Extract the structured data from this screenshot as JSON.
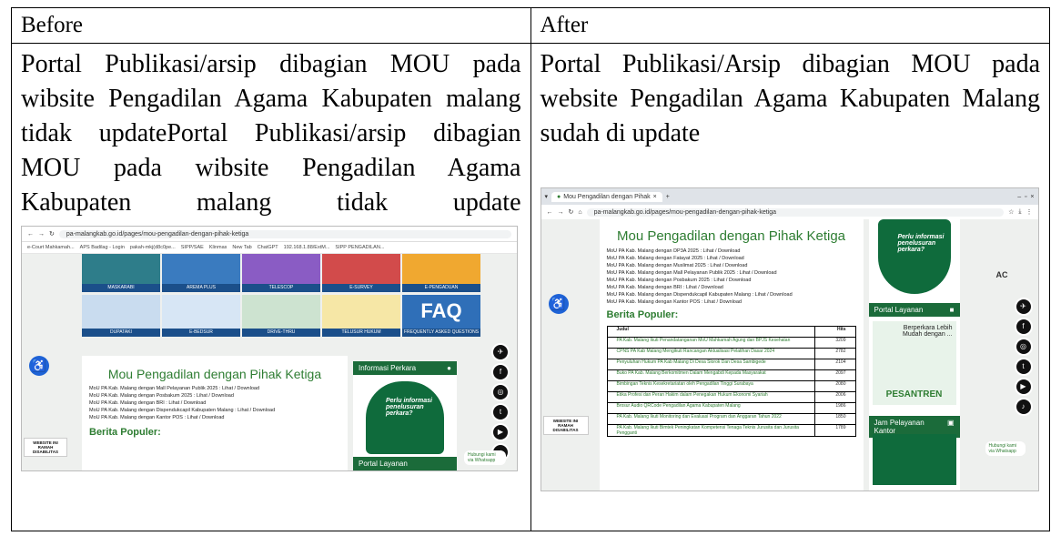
{
  "table": {
    "before_header": "Before",
    "after_header": "After",
    "before_text": "Portal Publikasi/arsip dibagian MOU pada wibsite Pengadilan Agama Kabupaten malang tidak updatePortal Publikasi/arsip dibagian MOU pada wibsite Pengadilan Agama Kabupaten malang tidak update",
    "after_text": "Portal Publikasi/Arsip dibagian MOU pada website Pengadilan Agama Kabupaten Malang sudah di update"
  },
  "before_shot": {
    "url": "pa-malangkab.go.id/pages/mou-pengadilan-dengan-pihak-ketiga",
    "bookmarks": [
      "e-Court Mahkamah...",
      "APS Badilag - Login",
      "pakah-mkj(d8c0pe...",
      "SIPP/SAE",
      "Klinmas",
      "New Tab",
      "ChatGPT",
      "192.168.1.88/ExtM...",
      "SIPP PENGADILAN..."
    ],
    "tiles_top": [
      "MASKARABI",
      "AREMA PLUS",
      "TELESCOP",
      "E-SURVEY",
      "E-PENGADUAN"
    ],
    "tiles_bottom": [
      "DUPATAKI",
      "E-BEDSUR",
      "DRIVE-THRU",
      "TELUSUR HUKUM",
      "FREQUENTLY ASKED QUESTIONS"
    ],
    "faq_label": "FAQ",
    "title": "Mou Pengadilan dengan Pihak Ketiga",
    "items": [
      "MoU PA Kab. Malang dengan Mall Pelayanan Publik 2025 : Lihat / Download",
      "MoU PA Kab. Malang dengan Posbakum 2025 : Lihat / Download",
      "MoU PA Kab. Malang dengan BRI : Lihat / Download",
      "MoU PA Kab. Malang dengan Dispendukcapil Kabupaten Malang : Lihat / Download",
      "MoU PA Kab. Malang dengan Kantor POS : Lihat / Download"
    ],
    "berita": "Berita Populer:",
    "side_title": "Informasi Perkara",
    "promo_text": "Perlu informasi penelusuran perkara?",
    "side_title2": "Portal Layanan",
    "wa": "Hubungi kami via Whatsapp",
    "disab": "WEBSITE INI RAMAH DISABILITAS"
  },
  "after_shot": {
    "tab_title": "Mou Pengadilan dengan Pihak",
    "url": "pa-malangkab.go.id/pages/mou-pengadilan-dengan-pihak-ketiga",
    "title": "Mou Pengadilan dengan Pihak Ketiga",
    "items": [
      "MoU PA Kab. Malang dengan DP3A 2025 : Lihat / Download",
      "MoU PA Kab. Malang dengan Fatayat 2025 : Lihat / Download",
      "MoU PA Kab. Malang dengan Muslimat 2025 : Lihat / Download",
      "MoU PA Kab. Malang dengan Mall Pelayanan Publik 2025 : Lihat / Download",
      "MoU PA Kab. Malang dengan Posbakum 2025 : Lihat / Download",
      "MoU PA Kab. Malang dengan BRI : Lihat / Download",
      "MoU PA Kab. Malang dengan Dispendukcapil Kabupaten Malang : Lihat / Download",
      "MoU PA Kab. Malang dengan Kantor POS : Lihat / Download"
    ],
    "berita": "Berita Populer:",
    "col_judul": "Judul",
    "col_hits": "Hits",
    "news": [
      {
        "t": "PA Kab. Malang Ikuti Penandatanganan MoU Mahkamah Agung dan BPJS Kesehatan",
        "h": "3209"
      },
      {
        "t": "CPNS PA Kab Malang Mengikuti Rancangan Aktualisasi Pelatihan Dasar 2024",
        "h": "2782"
      },
      {
        "t": "Penyuluhan Hukum PA Kab Malang Di Desa Slorok Dan Desa Sambigede",
        "h": "2104"
      },
      {
        "t": "Buko PA Kab. Malang Berkomitmen Dalam Mengabdi Kepada Masyarakat",
        "h": "2097"
      },
      {
        "t": "Bimbingan Teknis Kesekretariatan oleh Pengadilan Tinggi Surabaya",
        "h": "2080"
      },
      {
        "t": "Etika Profesi dan Peran Hakim dalam Penegakan Hukum Ekonomi Syariah",
        "h": "2006"
      },
      {
        "t": "Brosur Audio QRCode Pengadilan Agama Kabupaten Malang",
        "h": "1986"
      },
      {
        "t": "PA Kab. Malang Ikuti Monitoring dan Evaluasi Program dan Anggaran Tahun 2022",
        "h": "1850"
      },
      {
        "t": "PA Kab. Malang Ikuti Bimtek Peningkatan Kompetensi Tenaga Teknis Jurusita dan Jurusita Pengganti",
        "h": "1789"
      }
    ],
    "promo_text": "Perlu informasi penelusuran perkara?",
    "side_title": "Portal Layanan",
    "portal_text": "Berperkara Lebih Mudah dengan ...",
    "pesantren": "PESANTREN",
    "jam": "Jam Pelayanan Kantor",
    "wa": "Hubungi kami via Whatsapp",
    "disab": "WEBSITE INI RAMAH DISABILITAS",
    "ace": "AC"
  }
}
